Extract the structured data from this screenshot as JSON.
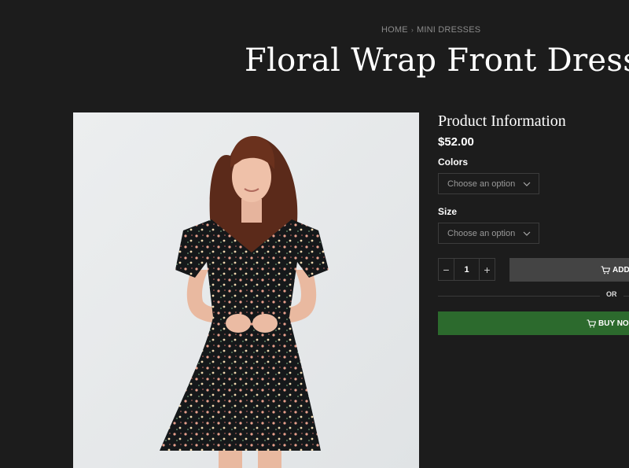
{
  "breadcrumb": {
    "home": "HOME",
    "separator": "›",
    "current": "MINI DRESSES"
  },
  "product": {
    "title": "Floral Wrap Front Dress",
    "info_heading": "Product Information",
    "price": "$52.00"
  },
  "options": {
    "colors": {
      "label": "Colors",
      "placeholder": "Choose an option"
    },
    "size": {
      "label": "Size",
      "placeholder": "Choose an option"
    }
  },
  "quantity": {
    "value": "1",
    "minus": "−",
    "plus": "+"
  },
  "actions": {
    "add_to_cart": "ADD TO CART",
    "or": "OR",
    "buy_now": "BUY NOW"
  },
  "colors": {
    "background": "#1c1c1c",
    "image_background": "#e7e9ea",
    "add_to_cart": "#444444",
    "buy_now": "#2c6a2d"
  },
  "icons": {
    "cart": "cart-icon",
    "chevron": "chevron-down-icon"
  }
}
